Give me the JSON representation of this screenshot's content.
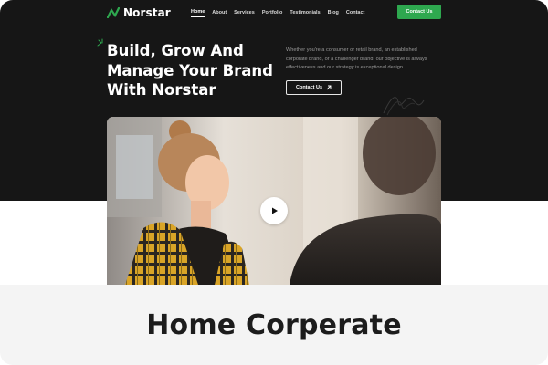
{
  "brand": {
    "name": "Norstar",
    "accent": "#2ea84f",
    "logo_icon": "zigzag-logo-icon"
  },
  "nav": {
    "items": [
      {
        "label": "Home",
        "active": true
      },
      {
        "label": "About"
      },
      {
        "label": "Services"
      },
      {
        "label": "Portfolio"
      },
      {
        "label": "Testimonials"
      },
      {
        "label": "Blog"
      },
      {
        "label": "Contact"
      }
    ],
    "cta_label": "Contact Us"
  },
  "hero": {
    "title_lines": [
      "Build, Grow And",
      "Manage Your Brand",
      "With Norstar"
    ],
    "description_lines": [
      "Whether you're a consumer or retail brand, an established",
      "corporate brand, or a challenger brand, our objective is always",
      "effectiveness and our strategy is exceptional design."
    ],
    "cta_label": "Contact Us",
    "cta_icon": "arrow-up-right-icon",
    "background": "#161616"
  },
  "media": {
    "play_icon": "play-icon"
  },
  "caption": {
    "text": "Home Corperate"
  }
}
